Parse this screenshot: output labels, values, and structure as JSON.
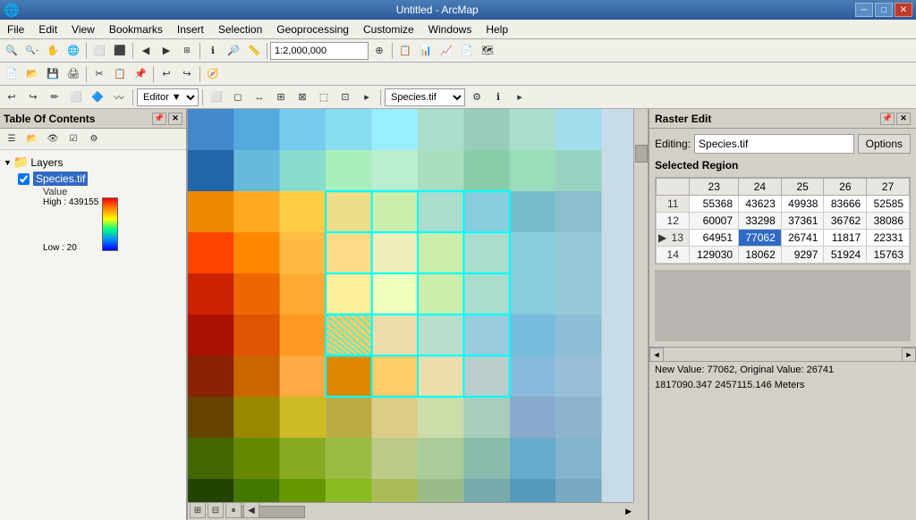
{
  "titleBar": {
    "title": "Untitled - ArcMap",
    "appIcon": "arcmap-icon",
    "minimizeLabel": "─",
    "restoreLabel": "□",
    "closeLabel": "✕"
  },
  "menuBar": {
    "items": [
      "File",
      "Edit",
      "View",
      "Bookmarks",
      "Insert",
      "Selection",
      "Geoprocessing",
      "Customize",
      "Windows",
      "Help"
    ]
  },
  "toolbar1": {
    "scale": "1:2,000,000"
  },
  "toolbar2": {
    "editorLabel": "Editor ▼",
    "layerDropdown": "Species.tif"
  },
  "toc": {
    "title": "Table Of Contents",
    "layers": {
      "name": "Layers",
      "children": [
        {
          "name": "Species.tif",
          "checked": true,
          "legendValue": "Value",
          "legendHigh": "High : 439155",
          "legendLow": "Low : 20"
        }
      ]
    }
  },
  "rasterEdit": {
    "title": "Raster Edit",
    "editingLabel": "Editing:",
    "editingValue": "Species.tif",
    "optionsLabel": "Options",
    "selectedRegionLabel": "Selected Region",
    "tableHeaders": [
      "",
      "23",
      "24",
      "25",
      "26",
      "27"
    ],
    "tableRows": [
      {
        "rowNum": "11",
        "values": [
          "55368",
          "43623",
          "49938",
          "83666",
          "52585"
        ],
        "arrow": false,
        "selectedCol": -1
      },
      {
        "rowNum": "12",
        "values": [
          "60007",
          "33298",
          "37361",
          "36762",
          "38086"
        ],
        "arrow": false,
        "selectedCol": -1
      },
      {
        "rowNum": "13",
        "values": [
          "64951",
          "77062",
          "26741",
          "11817",
          "22331"
        ],
        "arrow": true,
        "selectedCol": 1
      },
      {
        "rowNum": "14",
        "values": [
          "129030",
          "18062",
          "9297",
          "51924",
          "15763"
        ],
        "arrow": false,
        "selectedCol": -1
      }
    ],
    "scrollLeftLabel": "◄",
    "scrollRightLabel": "►",
    "statusLabel": "New Value: 77062, Original Value: 26741",
    "coordLabel": "1817090.347  2457115.146 Meters"
  }
}
